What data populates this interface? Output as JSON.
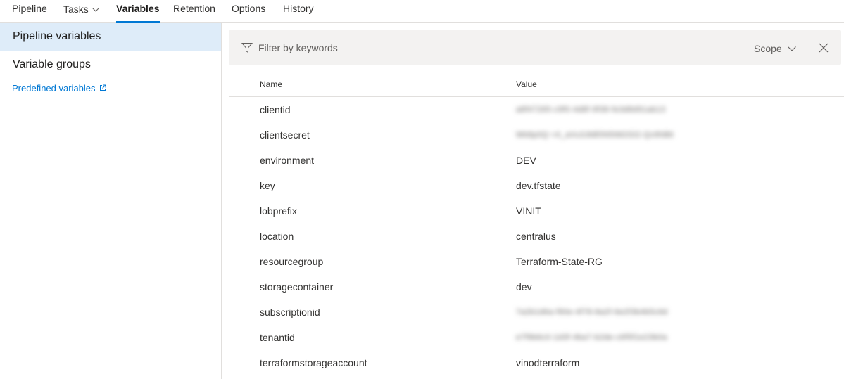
{
  "tabs": [
    {
      "label": "Pipeline"
    },
    {
      "label": "Tasks"
    },
    {
      "label": "Variables"
    },
    {
      "label": "Retention"
    },
    {
      "label": "Options"
    },
    {
      "label": "History"
    }
  ],
  "active_tab": "Variables",
  "sidebar": {
    "items": [
      {
        "label": "Pipeline variables",
        "selected": true
      },
      {
        "label": "Variable groups",
        "selected": false
      }
    ],
    "link_label": "Predefined variables"
  },
  "filter": {
    "placeholder": "Filter by keywords",
    "value": "",
    "scope_label": "Scope"
  },
  "table": {
    "columns": {
      "name": "Name",
      "value": "Value"
    },
    "rows": [
      {
        "name": "clientid",
        "value": "a8f47265-c9f0-4d8f-9f38-fe3d8d91ab13",
        "masked": true
      },
      {
        "name": "clientsecret",
        "value": "Wk8p0Q~r4_aVu3JkB5N5tM2Gl2-Qv9hB6",
        "masked": true
      },
      {
        "name": "environment",
        "value": "DEV",
        "masked": false
      },
      {
        "name": "key",
        "value": "dev.tfstate",
        "masked": false
      },
      {
        "name": "lobprefix",
        "value": "VINIT",
        "masked": false
      },
      {
        "name": "location",
        "value": "centralus",
        "masked": false
      },
      {
        "name": "resourcegroup",
        "value": "Terraform-State-RG",
        "masked": false
      },
      {
        "name": "storagecontainer",
        "value": "dev",
        "masked": false
      },
      {
        "name": "subscriptionid",
        "value": "7a2b1d6a-f90e-4f78-8a2f-6e2f3b4b5c6d",
        "masked": true
      },
      {
        "name": "tenantid",
        "value": "e7f9b6c0-1d3f-4ba7-b2de-c6f5f1e23b0a",
        "masked": true
      },
      {
        "name": "terraformstorageaccount",
        "value": "vinodterraform",
        "masked": false
      }
    ]
  },
  "colors": {
    "accent": "#0078d4",
    "selected_bg": "#deecf9",
    "filter_bg": "#f3f2f1",
    "border": "#e1dfdd"
  },
  "icons": [
    "chevron-down-icon",
    "external-link-icon",
    "filter-icon",
    "close-icon"
  ]
}
